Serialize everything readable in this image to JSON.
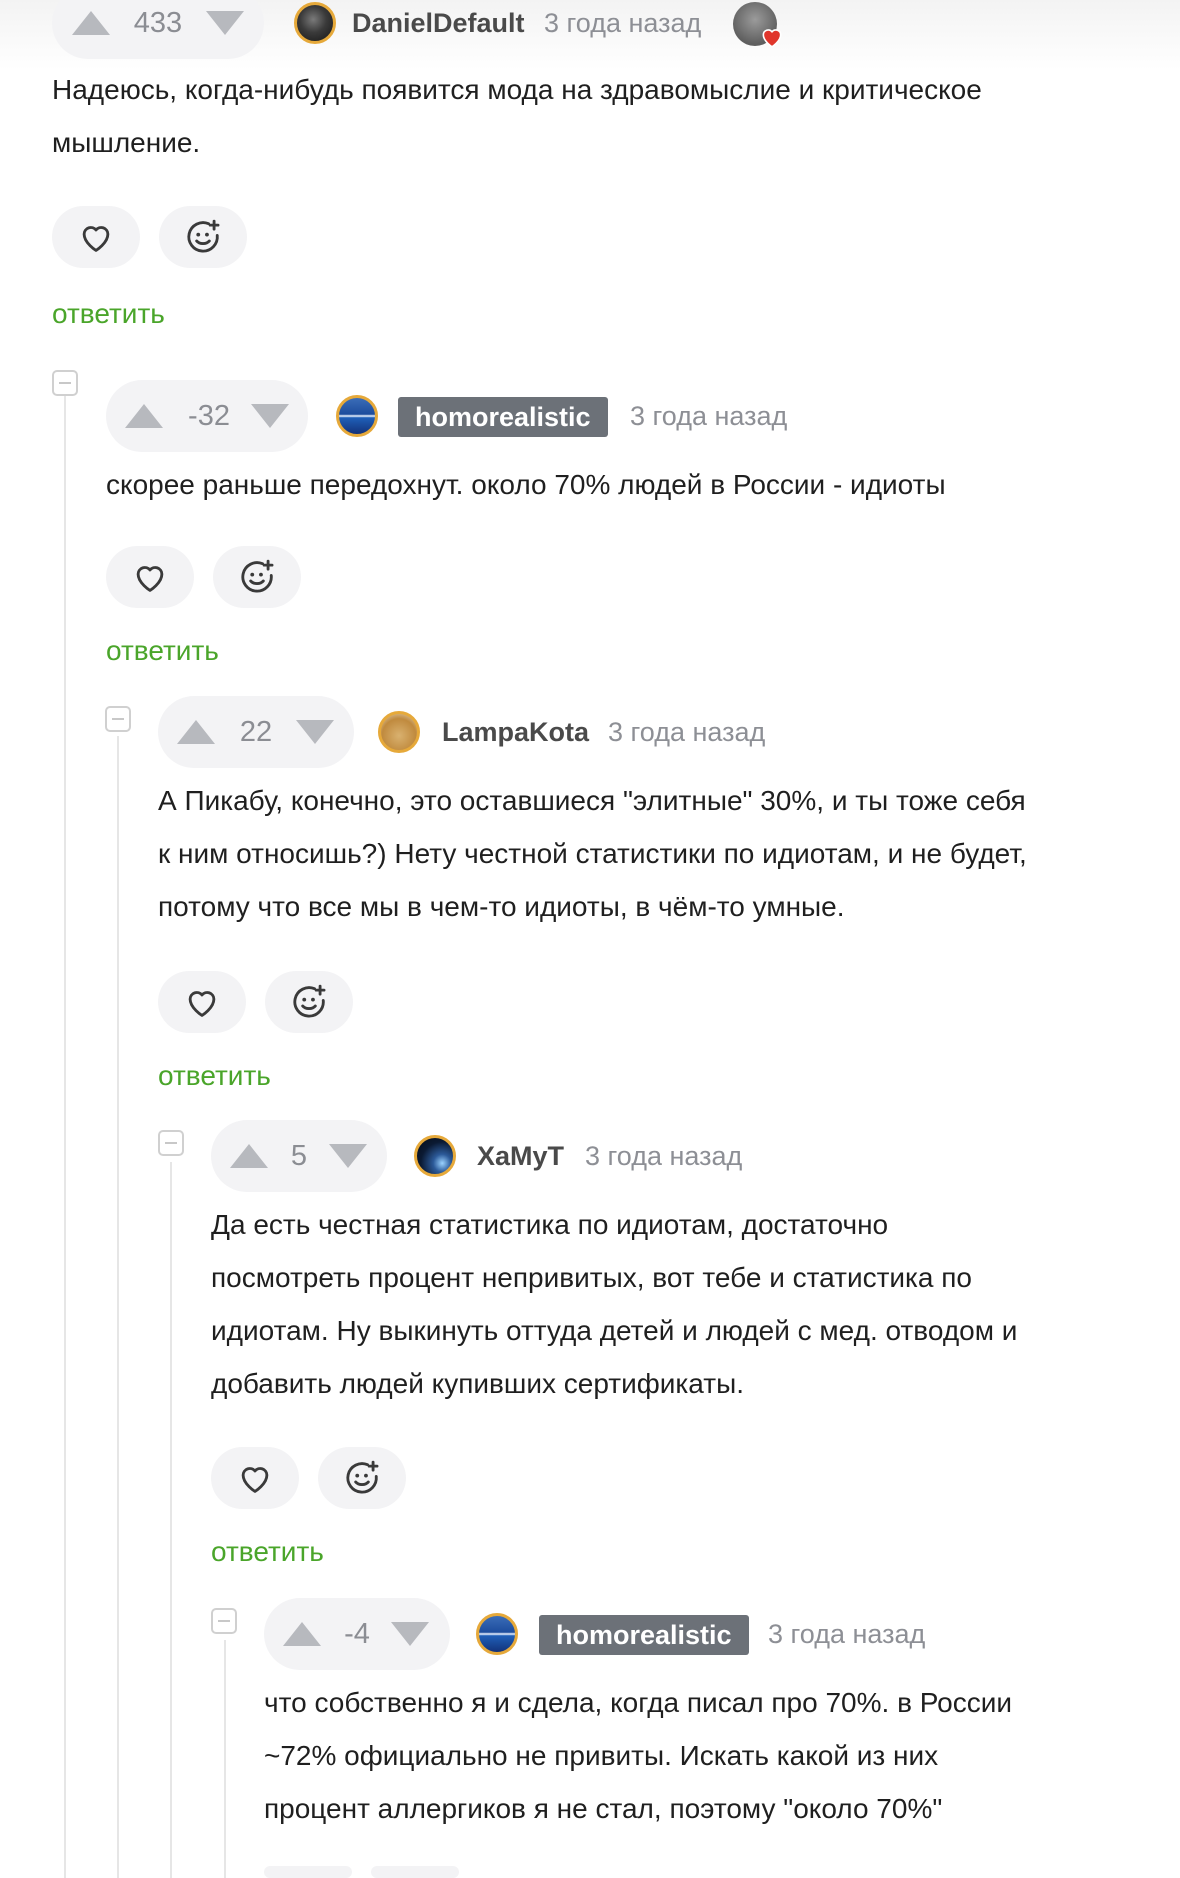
{
  "colors": {
    "accent_green": "#4aa52a",
    "badge_bg": "#6c7178",
    "vote_bg": "#f3f3f5"
  },
  "comments": [
    {
      "rating": "433",
      "author": "DanielDefault",
      "time": "3 года назад",
      "avatar": "dark-avatar",
      "badge": false,
      "lines": [
        "Надеюсь, когда-нибудь появится мода на здравомыслие и критическое",
        "мышление."
      ],
      "reply": "ответить"
    },
    {
      "rating": "-32",
      "author": "homorealistic",
      "time": "3 года назад",
      "avatar": "blue-avatar",
      "badge": true,
      "lines": [
        "скорее раньше передохнут. около 70% людей в России - идиоты"
      ],
      "reply": "ответить"
    },
    {
      "rating": "22",
      "author": "LampaKota",
      "time": "3 года назад",
      "avatar": "cat-avatar",
      "badge": false,
      "lines": [
        "А Пикабу, конечно, это оставшиеся \"элитные\" 30%, и ты тоже себя",
        "к ним относишь?) Нету честной статистики по идиотам, и не будет,",
        "потому что все мы в чем-то идиоты, в чём-то умные."
      ],
      "reply": "ответить"
    },
    {
      "rating": "5",
      "author": "ХаМуТ",
      "time": "3 года назад",
      "avatar": "space-avatar",
      "badge": false,
      "lines": [
        "Да есть честная статистика по идиотам, достаточно",
        "посмотреть процент непривитых, вот тебе и статистика по",
        "идиотам. Ну выкинуть оттуда детей и людей с мед. отводом и",
        "добавить людей купивших сертификаты."
      ],
      "reply": "ответить"
    },
    {
      "rating": "-4",
      "author": "homorealistic",
      "time": "3 года назад",
      "avatar": "blue-avatar",
      "badge": true,
      "lines": [
        "что собственно я и сдела, когда писал про 70%. в России",
        "~72% официально не привиты. Искать какой из них",
        "процент аллергиков я не стал, поэтому \"около 70%\""
      ],
      "reply": ""
    }
  ]
}
